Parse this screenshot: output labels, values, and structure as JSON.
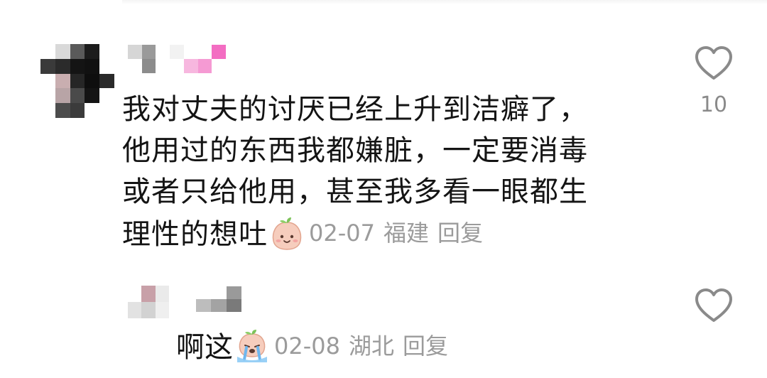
{
  "comment": {
    "lines": [
      "我对丈夫的讨厌已经上升到洁癖了，",
      "他用过的东西我都嫌脏，一定要消毒",
      "或者只给他用，甚至我多看一眼都生",
      "理性的想吐"
    ],
    "emoji": "peach-face-emoji",
    "date": "02-07",
    "location": "福建",
    "reply_label": "回复",
    "like_count": "10"
  },
  "reply": {
    "text": "啊这",
    "emoji": "peach-crying-emoji",
    "date": "02-08",
    "location": "湖北",
    "reply_label": "回复",
    "like_count": ""
  },
  "colors": {
    "text": "#141414",
    "meta": "#9b9b9b",
    "icon": "#8a8a8a",
    "peach": "#f6cdbd",
    "leaf": "#7dc35a",
    "pink": "#f59ad3"
  },
  "icons": [
    "heart-outline-icon",
    "peach-face-emoji",
    "peach-crying-emoji"
  ]
}
